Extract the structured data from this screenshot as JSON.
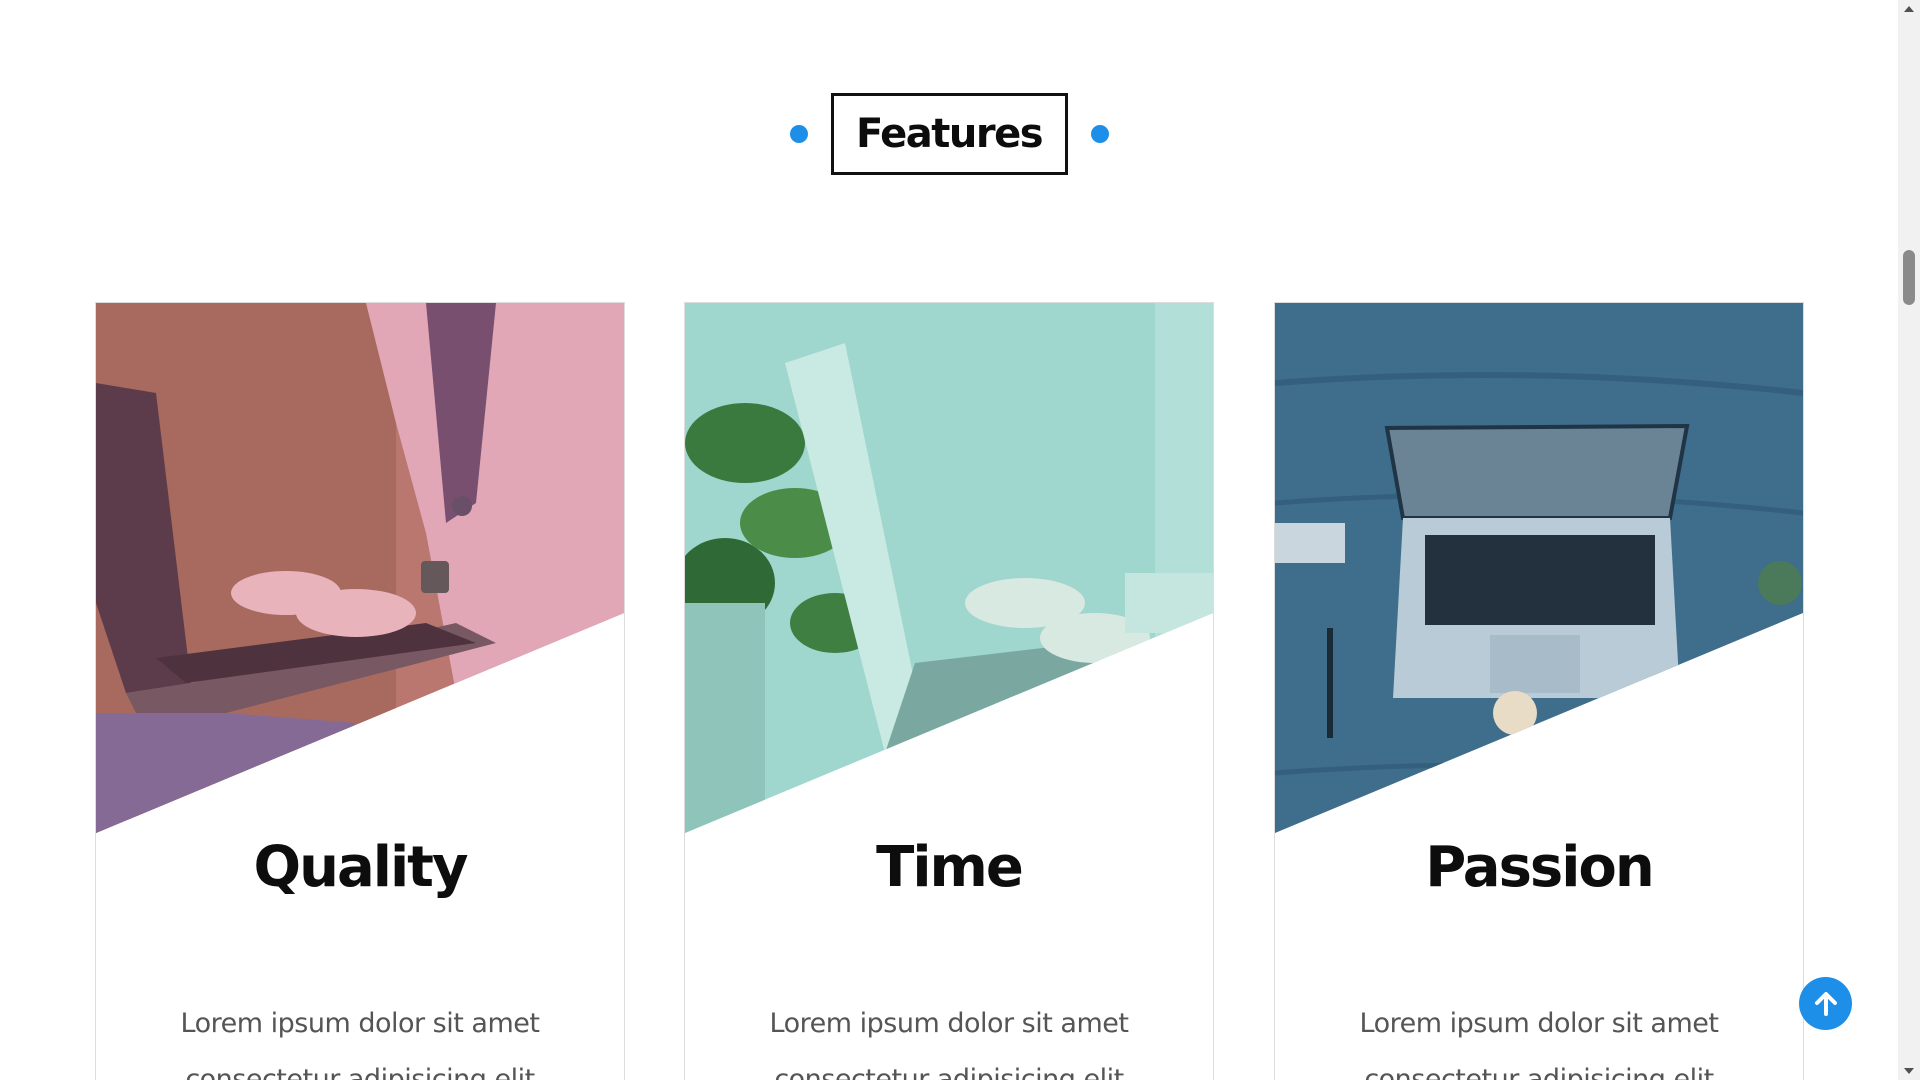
{
  "section": {
    "title": "Features"
  },
  "colors": {
    "accent": "#1e8fe8",
    "card1_overlay": "#c46a7a",
    "card2_overlay": "#7fd1c5",
    "card3_overlay": "#3f6d8c"
  },
  "cards": [
    {
      "title": "Quality",
      "text_line1": "Lorem ipsum dolor sit amet",
      "text_line2": "consectetur adipisicing elit"
    },
    {
      "title": "Time",
      "text_line1": "Lorem ipsum dolor sit amet",
      "text_line2": "consectetur adipisicing elit"
    },
    {
      "title": "Passion",
      "text_line1": "Lorem ipsum dolor sit amet",
      "text_line2": "consectetur adipisicing elit"
    }
  ],
  "icons": {
    "back_to_top": "arrow-up-icon",
    "scroll_up": "triangle-up-icon",
    "scroll_down": "triangle-down-icon"
  }
}
